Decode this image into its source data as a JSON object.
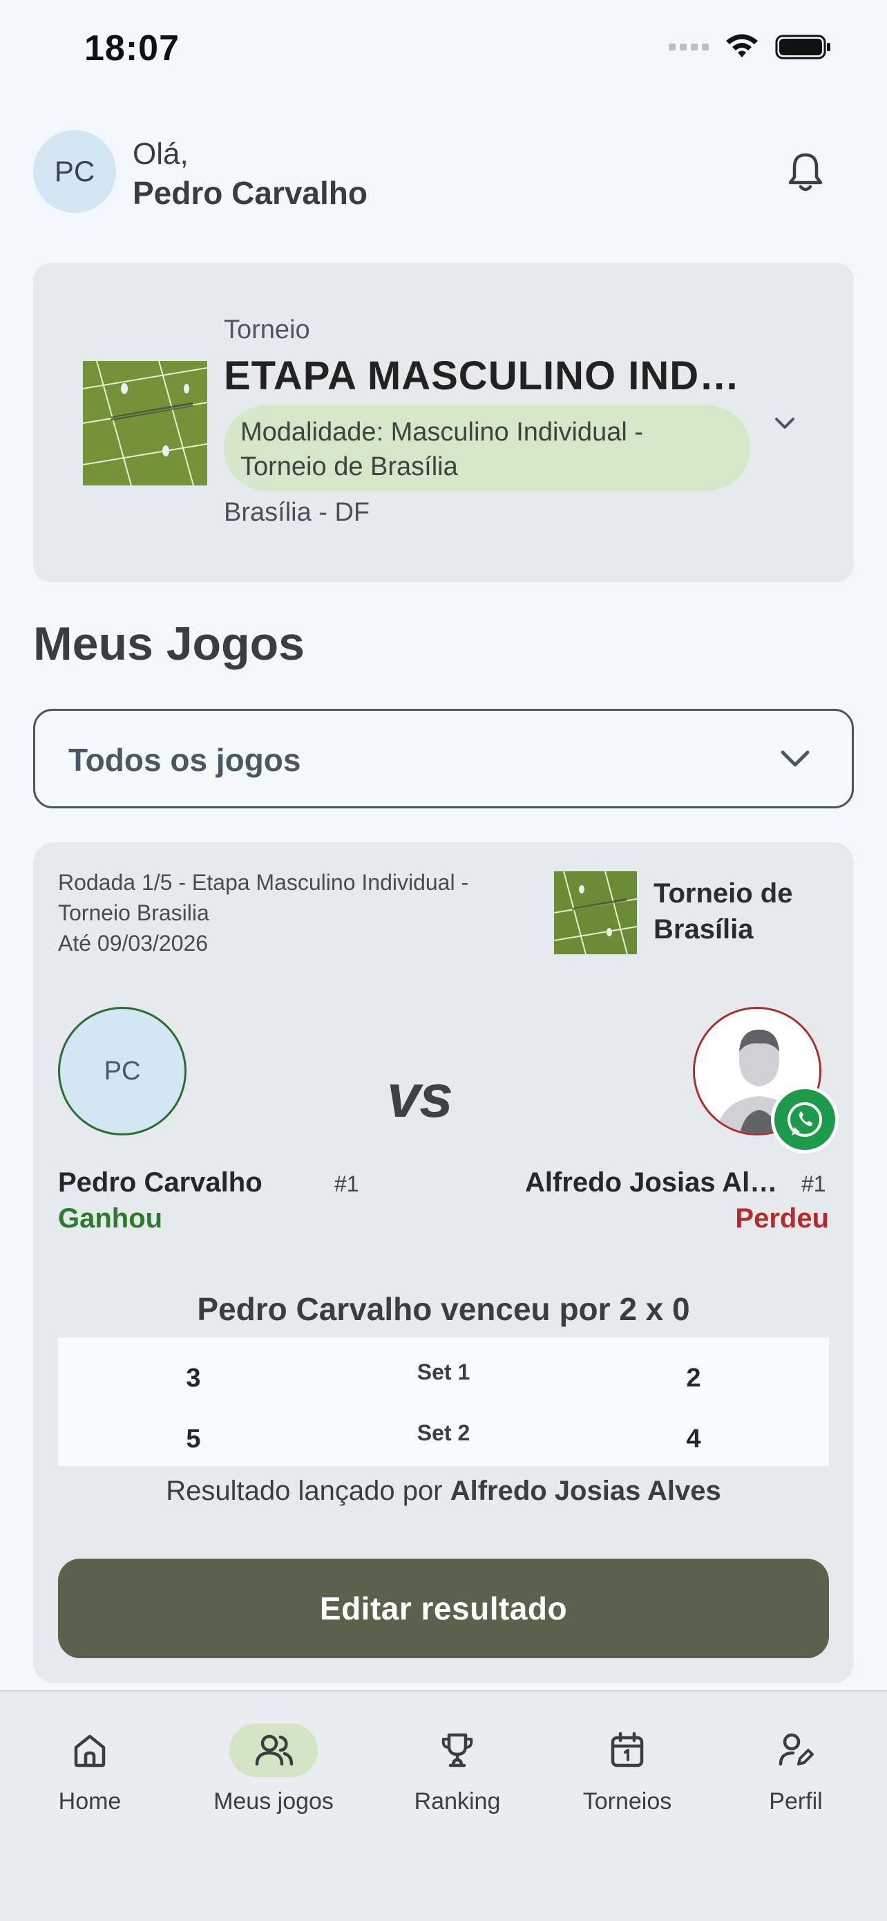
{
  "status_bar": {
    "time": "18:07"
  },
  "header": {
    "avatar_initials": "PC",
    "greeting": "Olá,",
    "user_name": "Pedro Carvalho"
  },
  "tournament": {
    "label": "Torneio",
    "name": "ETAPA MASCULINO INDIVIDUAL",
    "modality": "Modalidade: Masculino Individual - Torneio de Brasília",
    "location": "Brasília - DF"
  },
  "section_title": "Meus Jogos",
  "filter": {
    "selected": "Todos os jogos"
  },
  "match": {
    "round_line1": "Rodada 1/5 - Etapa Masculino Individual -",
    "round_line2": "Torneio Brasilia",
    "deadline": "Até 09/03/2026",
    "tournament_name": "Torneio de Brasília",
    "vs": "vs",
    "player1": {
      "initials": "PC",
      "name": "Pedro Carvalho",
      "rank": "#1",
      "result": "Ganhou"
    },
    "player2": {
      "name": "Alfredo Josias Alves",
      "rank": "#1",
      "result": "Perdeu"
    },
    "winner_text": "Pedro Carvalho venceu por 2 x 0",
    "sets": [
      {
        "a": "3",
        "label": "Set 1",
        "b": "2"
      },
      {
        "a": "5",
        "label": "Set 2",
        "b": "4"
      }
    ],
    "posted_by_prefix": "Resultado lançado por",
    "posted_by_name": "Alfredo Josias Alves",
    "edit_button": "Editar resultado"
  },
  "colors": {
    "win": "#2d7a2f",
    "loss": "#b52b2b",
    "button": "#58624c",
    "active_tab": "#d4e5c6"
  },
  "tabbar": {
    "items": [
      {
        "label": "Home",
        "icon": "home-icon"
      },
      {
        "label": "Meus jogos",
        "icon": "users-icon",
        "active": true
      },
      {
        "label": "Ranking",
        "icon": "trophy-icon"
      },
      {
        "label": "Torneios",
        "icon": "calendar-icon"
      },
      {
        "label": "Perfil",
        "icon": "user-edit-icon"
      }
    ]
  }
}
